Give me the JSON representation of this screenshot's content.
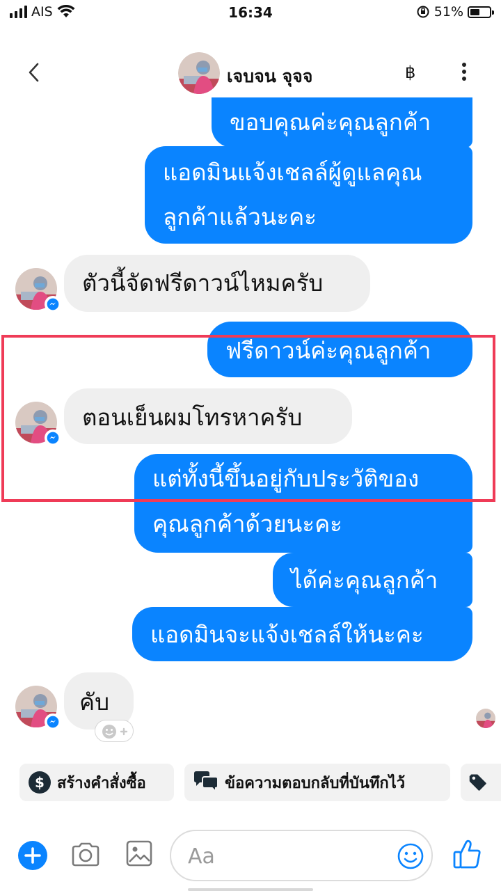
{
  "status": {
    "carrier": "AIS",
    "time": "16:34",
    "battery": "51%",
    "battery_level": 0.51
  },
  "header": {
    "name": "เจบจน จุจจ",
    "currency_icon": "฿"
  },
  "messages": [
    {
      "side": "out",
      "text": "ขอบคุณค่ะคุณลูกค้า"
    },
    {
      "side": "out",
      "lines": [
        "แอดมินแจ้งเชลล์ผู้ดูแลคุณ",
        "ลูกค้าแล้วนะคะ"
      ]
    },
    {
      "side": "in",
      "text": "ตัวนี้จัดฟรีดาวน์ไหมครับ"
    },
    {
      "side": "out",
      "text": "ฟรีดาวน์ค่ะคุณลูกค้า"
    },
    {
      "side": "in",
      "text": "ตอนเย็นผมโทรหาครับ"
    },
    {
      "side": "out",
      "lines": [
        "แต่ทั้งนี้ขึ้นอยู่กับประวัติของ",
        "คุณลูกค้าด้วยนะคะ"
      ]
    },
    {
      "side": "out",
      "text": "ได้ค่ะคุณลูกค้า"
    },
    {
      "side": "out",
      "text": "แอดมินจะแจ้งเชลล์ให้นะคะ"
    },
    {
      "side": "in",
      "text": "คับ"
    }
  ],
  "chips": [
    {
      "label": "สร้างคำสั่งซื้อ",
      "icon": "dollar-circle-icon"
    },
    {
      "label": "ข้อความตอบกลับที่บันทึกไว้",
      "icon": "chat-bubbles-icon"
    },
    {
      "label": "",
      "icon": "tag-icon"
    }
  ],
  "composer": {
    "placeholder": "Aa"
  },
  "colors": {
    "accent": "#0a84ff",
    "incoming": "#efefef",
    "highlight": "#ef3b57"
  }
}
